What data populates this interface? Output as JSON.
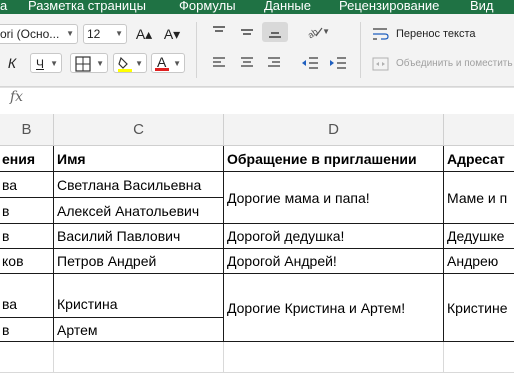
{
  "menu": {
    "tabs": [
      "а",
      "Разметка страницы",
      "Формулы",
      "Данные",
      "Рецензирование",
      "Вид"
    ]
  },
  "ribbon": {
    "font_name": "ori (Осно...",
    "font_size": "12",
    "grow_font": "A▴",
    "shrink_font": "A▾",
    "italic": "К",
    "underline": "Ч",
    "wrap_text": "Перенос текста",
    "merge_center": "Объединить и поместить"
  },
  "formula_bar": {
    "fx": "fx",
    "value": ""
  },
  "columns": {
    "b": "B",
    "c": "C",
    "d": "D"
  },
  "table": {
    "headers": [
      "ения",
      "Имя",
      "Обращение в приглашении",
      "Адресат"
    ],
    "col_b": [
      "ва",
      "в",
      "в",
      "ков",
      "ва",
      "в"
    ],
    "names": [
      "Светлана Васильевна",
      "Алексей Анатольевич",
      "Василий Павлович",
      "Петров Андрей",
      "Кристина",
      "Артем"
    ],
    "greetings": [
      "Дорогие мама и папа!",
      "Дорогой дедушка!",
      "Дорогой Андрей!",
      "Дорогие Кристина и Артем!"
    ],
    "addressees": [
      "Маме и п",
      "Дедушке",
      "Андрею",
      "Кристине"
    ]
  },
  "colors": {
    "menu_bg": "#1f7244",
    "fill_swatch": "#ffff00",
    "font_swatch": "#e02020",
    "grid_border": "#1a1a1a"
  }
}
